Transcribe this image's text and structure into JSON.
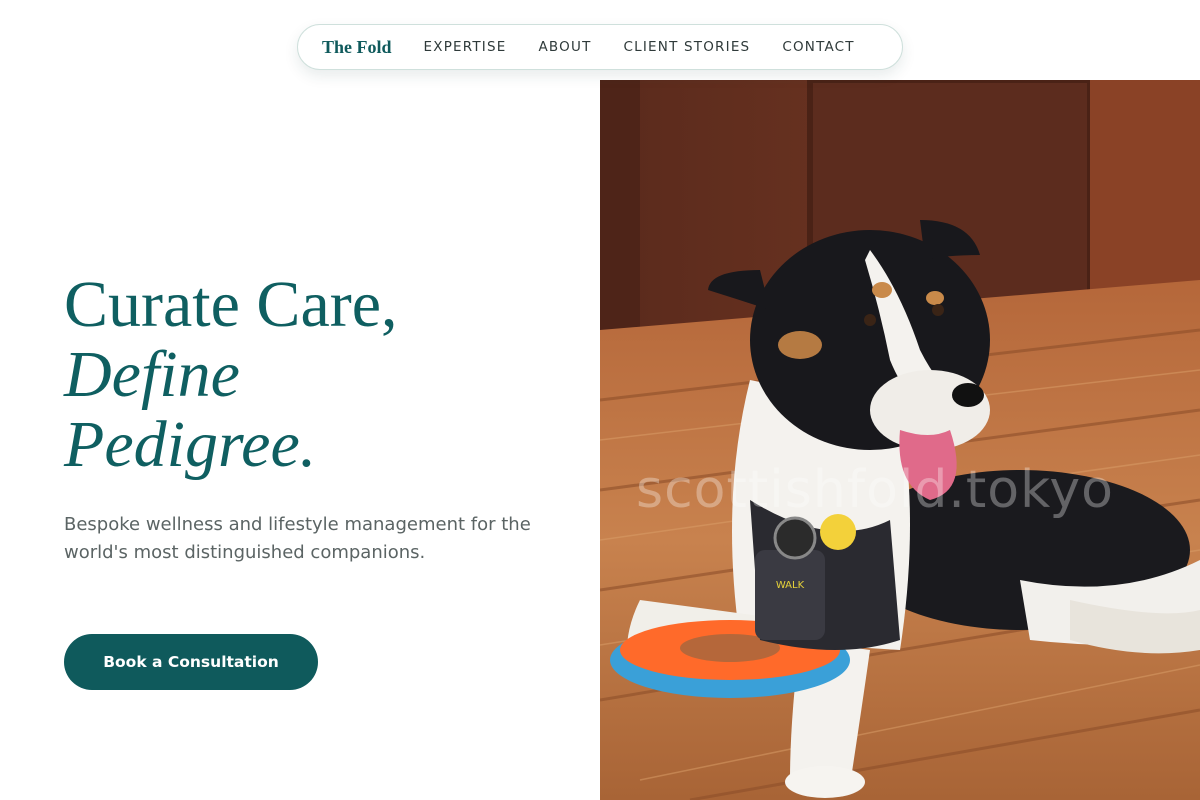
{
  "nav": {
    "brand": "The Fold",
    "links": [
      "EXPERTISE",
      "ABOUT",
      "CLIENT STORIES",
      "CONTACT"
    ]
  },
  "hero": {
    "headline_line1": "Curate Care,",
    "headline_line2": "Define",
    "headline_line3": "Pedigree.",
    "subtitle": "Bespoke wellness and lifestyle management for the world's most distinguished companions.",
    "cta_label": "Book a Consultation",
    "image_watermark": "scottishfold.tokyo",
    "image_alt": "Black and white dog lying on a wooden deck with a frisbee, wearing a harness"
  },
  "colors": {
    "accent": "#0f5a5c",
    "headline": "#0f5f61",
    "body_text": "#5b6464",
    "nav_text": "#2f3a3a"
  }
}
